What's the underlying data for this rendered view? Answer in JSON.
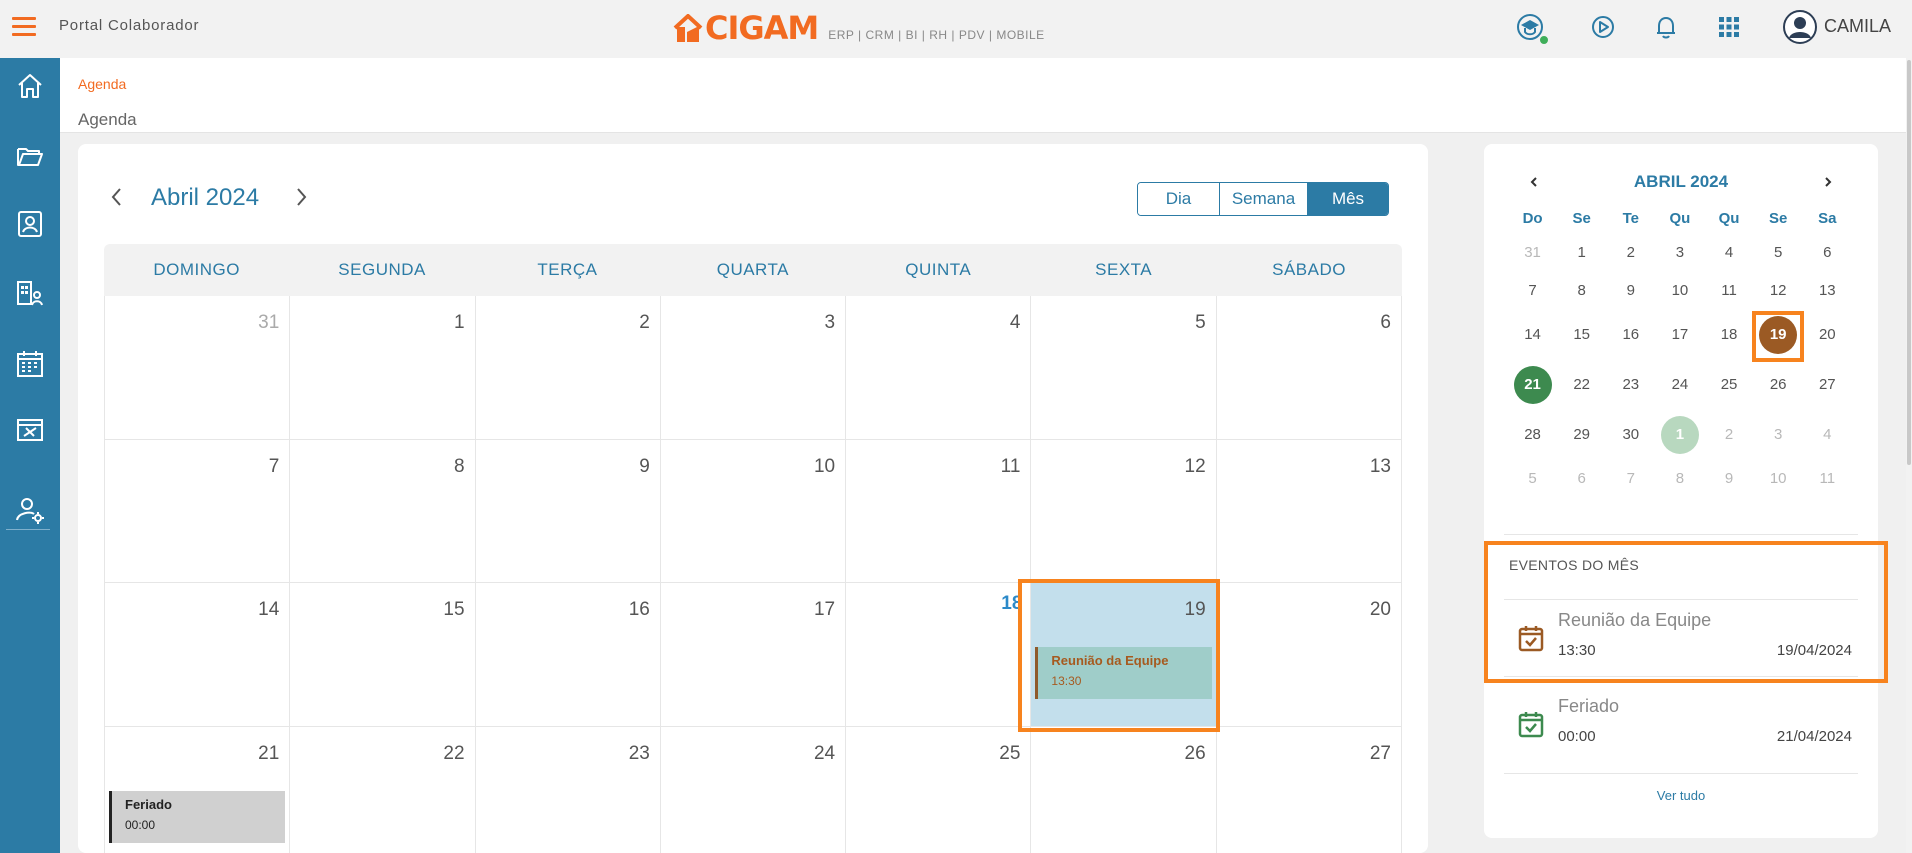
{
  "topbar": {
    "portal_title": "Portal Colaborador",
    "brand": "CIGAM",
    "brand_sub": "ERP | CRM | BI | RH | PDV | MOBILE",
    "user_name": "CAMILA",
    "icons": [
      "academy-icon",
      "play-circle-icon",
      "bell-icon",
      "apps-grid-icon"
    ],
    "accent_color": "#f26b21"
  },
  "sidebar": {
    "color": "#2c7ba5",
    "items": [
      "home-icon",
      "folder-icon",
      "user-badge-icon",
      "org-chart-icon",
      "calendar-icon",
      "paychecks-icon",
      "user-settings-icon"
    ]
  },
  "header": {
    "breadcrumb": "Agenda",
    "title": "Agenda"
  },
  "calendar": {
    "month_title": "Abril 2024",
    "views": [
      "Dia",
      "Semana",
      "Mês"
    ],
    "active_view": "Mês",
    "weekdays": [
      "DOMINGO",
      "SEGUNDA",
      "TERÇA",
      "QUARTA",
      "QUINTA",
      "SEXTA",
      "SÁBADO"
    ],
    "weeks": [
      [
        "31",
        "1",
        "2",
        "3",
        "4",
        "5",
        "6"
      ],
      [
        "7",
        "8",
        "9",
        "10",
        "11",
        "12",
        "13"
      ],
      [
        "14",
        "15",
        "16",
        "17",
        "18",
        "19",
        "20"
      ],
      [
        "21",
        "22",
        "23",
        "24",
        "25",
        "26",
        "27"
      ]
    ],
    "today": "18",
    "selected": "19",
    "events": {
      "team": {
        "title": "Reunião da Equipe",
        "time": "13:30"
      },
      "holiday": {
        "title": "Feriado",
        "time": "00:00"
      }
    }
  },
  "mini_calendar": {
    "title": "ABRIL 2024",
    "weekdays": [
      "Do",
      "Se",
      "Te",
      "Qu",
      "Qu",
      "Se",
      "Sa"
    ],
    "weeks": [
      [
        "31",
        "1",
        "2",
        "3",
        "4",
        "5",
        "6"
      ],
      [
        "7",
        "8",
        "9",
        "10",
        "11",
        "12",
        "13"
      ],
      [
        "14",
        "15",
        "16",
        "17",
        "18",
        "19",
        "20"
      ],
      [
        "21",
        "22",
        "23",
        "24",
        "25",
        "26",
        "27"
      ],
      [
        "28",
        "29",
        "30",
        "1",
        "2",
        "3",
        "4"
      ],
      [
        "5",
        "6",
        "7",
        "8",
        "9",
        "10",
        "11"
      ]
    ]
  },
  "month_events": {
    "heading": "EVENTOS DO MÊS",
    "items": [
      {
        "title": "Reunião da Equipe",
        "time": "13:30",
        "date": "19/04/2024",
        "color": "#9b5a24"
      },
      {
        "title": "Feriado",
        "time": "00:00",
        "date": "21/04/2024",
        "color": "#3d8a4f"
      }
    ],
    "see_all": "Ver tudo"
  }
}
